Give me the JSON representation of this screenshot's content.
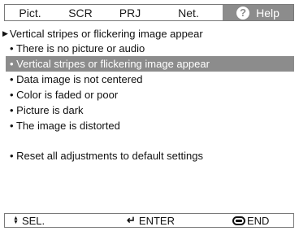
{
  "tabs": [
    "Pict.",
    "SCR",
    "PRJ",
    "Net."
  ],
  "help_tab": {
    "label": "Help",
    "icon": "question-icon"
  },
  "heading": "Vertical stripes or flickering image appear",
  "items": [
    {
      "label": "There is no picture or audio",
      "selected": false
    },
    {
      "label": "Vertical stripes or flickering image appear",
      "selected": true
    },
    {
      "label": "Data image is not centered",
      "selected": false
    },
    {
      "label": "Color is faded or poor",
      "selected": false
    },
    {
      "label": "Picture is dark",
      "selected": false
    },
    {
      "label": "The image is distorted",
      "selected": false
    }
  ],
  "reset": "Reset all adjustments to default settings",
  "bottom": {
    "sel": "SEL.",
    "enter": "ENTER",
    "end": "END"
  },
  "colors": {
    "highlight": "#8c8c8c",
    "border": "#7a7a7a"
  }
}
